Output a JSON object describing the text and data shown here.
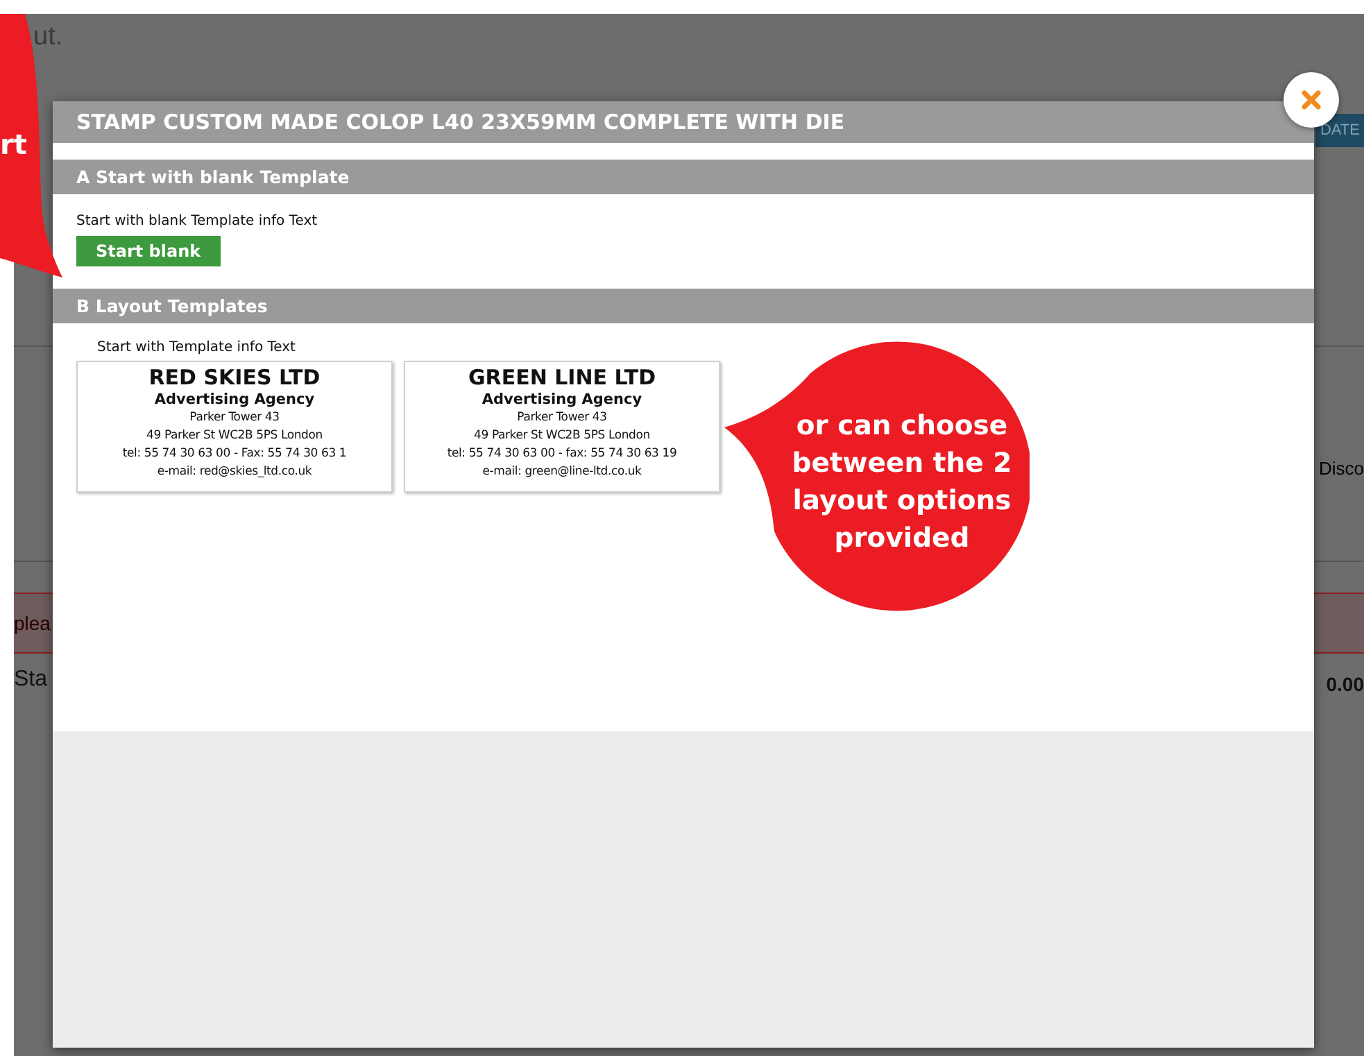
{
  "background_page": {
    "intro_text": "ut.",
    "update_button": "DATE",
    "column_label": "Disco",
    "notice": "plea",
    "row_label": "Sta",
    "row_value": "0.00"
  },
  "modal": {
    "title": "STAMP CUSTOM MADE COLOP L40 23X59MM COMPLETE WITH DIE",
    "sections": [
      {
        "kind": "blank",
        "heading": "A Start with blank Template",
        "info": "Start with blank Template info Text",
        "button": "Start blank"
      },
      {
        "kind": "templates",
        "heading": "B Layout Templates",
        "info": "Start with Template info Text",
        "templates": [
          {
            "lines": [
              "RED SKIES LTD",
              "Advertising Agency",
              "Parker Tower 43",
              "49 Parker St WC2B 5PS London",
              "tel: 55 74 30 63 00 - Fax: 55 74 30 63 1",
              "e-mail: red@skies_ltd.co.uk"
            ]
          },
          {
            "lines": [
              "GREEN LINE LTD",
              "Advertising Agency",
              "Parker Tower 43",
              "49 Parker St WC2B 5PS London",
              "tel: 55 74 30 63 00 - fax: 55 74 30 63 19",
              "e-mail: green@line-ltd.co.uk"
            ]
          }
        ]
      }
    ]
  },
  "callouts": [
    {
      "kind": "left",
      "text": "rt"
    },
    {
      "kind": "right",
      "text": "or can choose between the 2 layout options provided"
    }
  ]
}
